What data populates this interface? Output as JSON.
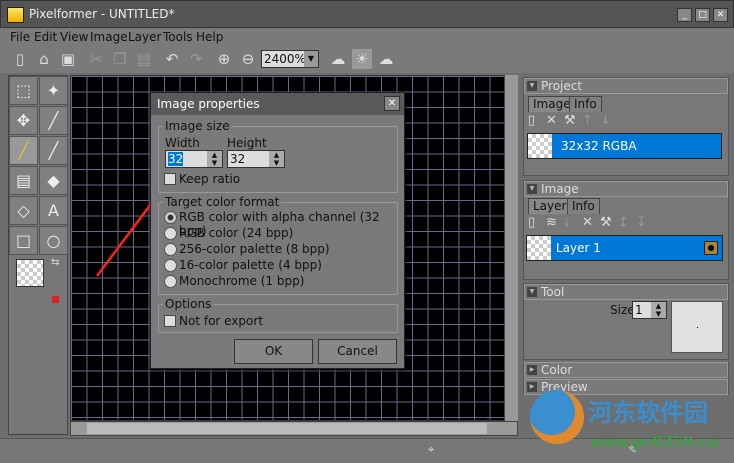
{
  "window": {
    "title": "Pixelformer - UNTITLED*"
  },
  "menu": [
    "File",
    "Edit",
    "View",
    "Image",
    "Layer",
    "Tools",
    "Help"
  ],
  "toolbar": {
    "zoom": "2400%"
  },
  "dialog": {
    "title": "Image properties",
    "size_legend": "Image size",
    "width_label": "Width",
    "width_value": "32",
    "height_label": "Height",
    "height_value": "32",
    "keep_ratio": "Keep ratio",
    "format_legend": "Target color format",
    "formats": [
      "RGB color with alpha channel (32 bpp)",
      "RGB color (24 bpp)",
      "256-color palette (8 bpp)",
      "16-color palette (4 bpp)",
      "Monochrome (1 bpp)"
    ],
    "options_legend": "Options",
    "not_for_export": "Not for export",
    "ok": "OK",
    "cancel": "Cancel"
  },
  "project": {
    "title": "Project",
    "tabs": [
      "Images",
      "Info"
    ],
    "item": "32x32 RGBA"
  },
  "image": {
    "title": "Image",
    "tabs": [
      "Layers",
      "Info"
    ],
    "layer": "Layer 1"
  },
  "tool": {
    "title": "Tool",
    "size_label": "Size:",
    "size_value": "1"
  },
  "color": {
    "title": "Color"
  },
  "preview": {
    "title": "Preview"
  },
  "watermark": {
    "text": "河东软件园",
    "url": "www.pc0359.cn"
  },
  "colors": {
    "selection": "#0078d7",
    "arrow": "#ff2020"
  }
}
